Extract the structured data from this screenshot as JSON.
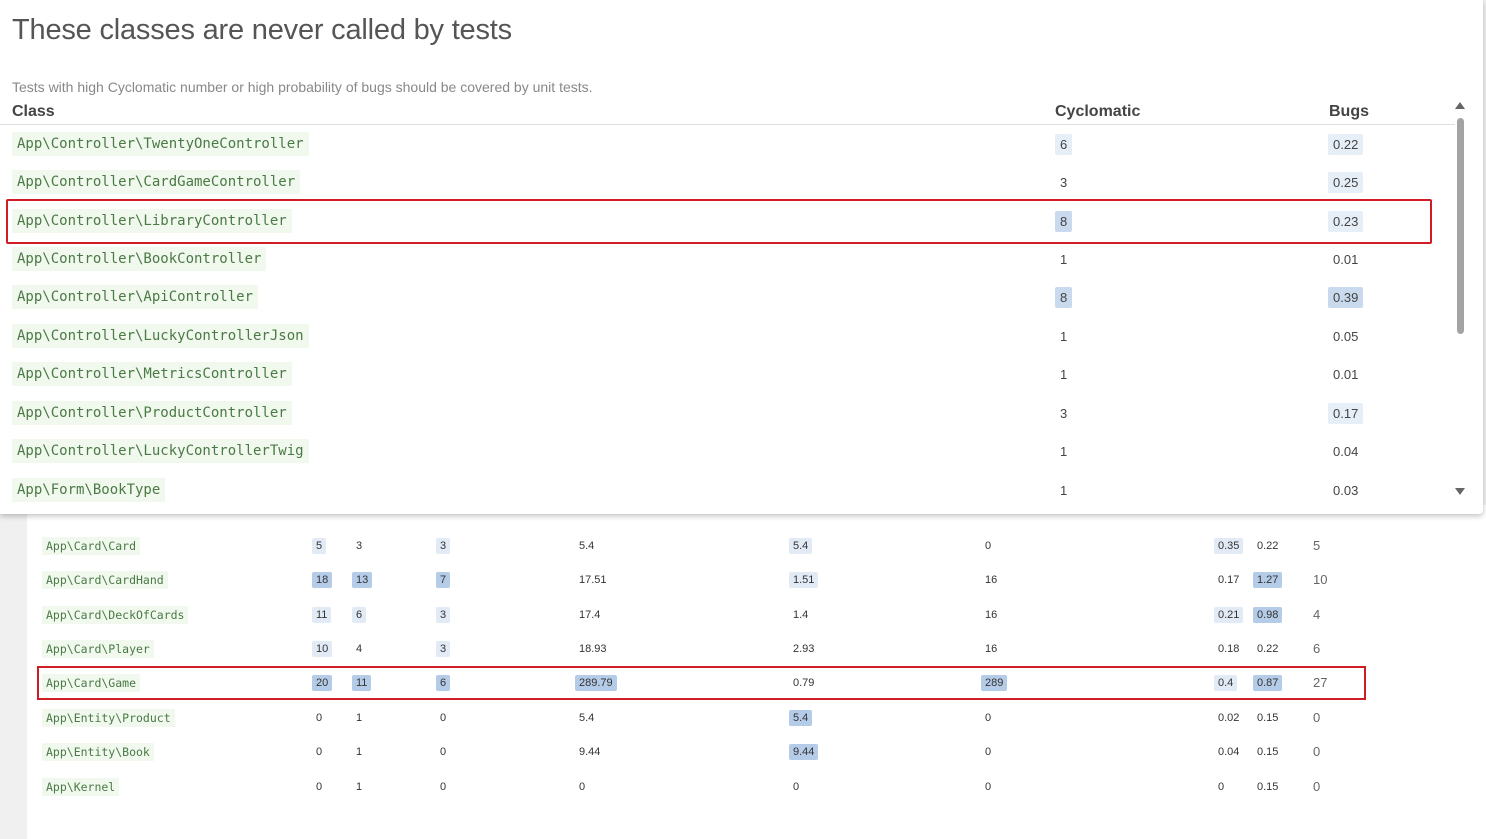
{
  "modal": {
    "title": "These classes are never called by tests",
    "subtitle": "Tests with high Cyclomatic number or high probability of bugs should be covered by unit tests.",
    "headers": {
      "class": "Class",
      "cyclomatic": "Cyclomatic",
      "bugs": "Bugs"
    },
    "rows": [
      {
        "class": "App\\Controller\\TwentyOneController",
        "cyclomatic": "6",
        "bugs": "0.22",
        "cyc_style": "light",
        "bugs_style": "light"
      },
      {
        "class": "App\\Controller\\CardGameController",
        "cyclomatic": "3",
        "bugs": "0.25",
        "cyc_style": "none",
        "bugs_style": "light"
      },
      {
        "class": "App\\Controller\\LibraryController",
        "cyclomatic": "8",
        "bugs": "0.23",
        "cyc_style": "strong",
        "bugs_style": "light"
      },
      {
        "class": "App\\Controller\\BookController",
        "cyclomatic": "1",
        "bugs": "0.01",
        "cyc_style": "none",
        "bugs_style": "none"
      },
      {
        "class": "App\\Controller\\ApiController",
        "cyclomatic": "8",
        "bugs": "0.39",
        "cyc_style": "strong",
        "bugs_style": "strong"
      },
      {
        "class": "App\\Controller\\LuckyControllerJson",
        "cyclomatic": "1",
        "bugs": "0.05",
        "cyc_style": "none",
        "bugs_style": "none"
      },
      {
        "class": "App\\Controller\\MetricsController",
        "cyclomatic": "1",
        "bugs": "0.01",
        "cyc_style": "none",
        "bugs_style": "none"
      },
      {
        "class": "App\\Controller\\ProductController",
        "cyclomatic": "3",
        "bugs": "0.17",
        "cyc_style": "none",
        "bugs_style": "light"
      },
      {
        "class": "App\\Controller\\LuckyControllerTwig",
        "cyclomatic": "1",
        "bugs": "0.04",
        "cyc_style": "none",
        "bugs_style": "none"
      },
      {
        "class": "App\\Form\\BookType",
        "cyclomatic": "1",
        "bugs": "0.03",
        "cyc_style": "none",
        "bugs_style": "none"
      }
    ]
  },
  "background_table": {
    "rows": [
      {
        "class": "App\\Card\\Card",
        "c1": "5",
        "c2": "3",
        "c3": "3",
        "c4": "5.4",
        "c5": "5.4",
        "c6": "0",
        "c7": "0.35",
        "c8": "0.22",
        "c9": "5",
        "s": [
          "lt",
          "none",
          "lt",
          "none",
          "lt",
          "none",
          "lt",
          "none"
        ]
      },
      {
        "class": "App\\Card\\CardHand",
        "c1": "18",
        "c2": "13",
        "c3": "7",
        "c4": "17.51",
        "c5": "1.51",
        "c6": "16",
        "c7": "0.17",
        "c8": "1.27",
        "c9": "10",
        "s": [
          "hl",
          "hl",
          "hl",
          "none",
          "lt",
          "none",
          "none",
          "hl"
        ]
      },
      {
        "class": "App\\Card\\DeckOfCards",
        "c1": "11",
        "c2": "6",
        "c3": "3",
        "c4": "17.4",
        "c5": "1.4",
        "c6": "16",
        "c7": "0.21",
        "c8": "0.98",
        "c9": "4",
        "s": [
          "lt",
          "lt",
          "lt",
          "none",
          "none",
          "none",
          "lt",
          "hl"
        ]
      },
      {
        "class": "App\\Card\\Player",
        "c1": "10",
        "c2": "4",
        "c3": "3",
        "c4": "18.93",
        "c5": "2.93",
        "c6": "16",
        "c7": "0.18",
        "c8": "0.22",
        "c9": "6",
        "s": [
          "lt",
          "none",
          "lt",
          "none",
          "none",
          "none",
          "none",
          "none"
        ]
      },
      {
        "class": "App\\Card\\Game",
        "c1": "20",
        "c2": "11",
        "c3": "6",
        "c4": "289.79",
        "c5": "0.79",
        "c6": "289",
        "c7": "0.4",
        "c8": "0.87",
        "c9": "27",
        "s": [
          "hl",
          "hl",
          "hl",
          "hl",
          "none",
          "hl",
          "lt",
          "hl"
        ]
      },
      {
        "class": "App\\Entity\\Product",
        "c1": "0",
        "c2": "1",
        "c3": "0",
        "c4": "5.4",
        "c5": "5.4",
        "c6": "0",
        "c7": "0.02",
        "c8": "0.15",
        "c9": "0",
        "s": [
          "none",
          "none",
          "none",
          "none",
          "hl",
          "none",
          "none",
          "none"
        ]
      },
      {
        "class": "App\\Entity\\Book",
        "c1": "0",
        "c2": "1",
        "c3": "0",
        "c4": "9.44",
        "c5": "9.44",
        "c6": "0",
        "c7": "0.04",
        "c8": "0.15",
        "c9": "0",
        "s": [
          "none",
          "none",
          "none",
          "none",
          "hl",
          "none",
          "none",
          "none"
        ]
      },
      {
        "class": "App\\Kernel",
        "c1": "0",
        "c2": "1",
        "c3": "0",
        "c4": "0",
        "c5": "0",
        "c6": "0",
        "c7": "0",
        "c8": "0.15",
        "c9": "0",
        "s": [
          "none",
          "none",
          "none",
          "none",
          "none",
          "none",
          "none",
          "none"
        ]
      }
    ]
  },
  "colors": {
    "highlight_border": "#d01c24",
    "class_text": "#4a7a45",
    "class_bg": "#f1f8ee",
    "badge_strong": "#b5cce8",
    "badge_light": "#e2ebf5"
  }
}
